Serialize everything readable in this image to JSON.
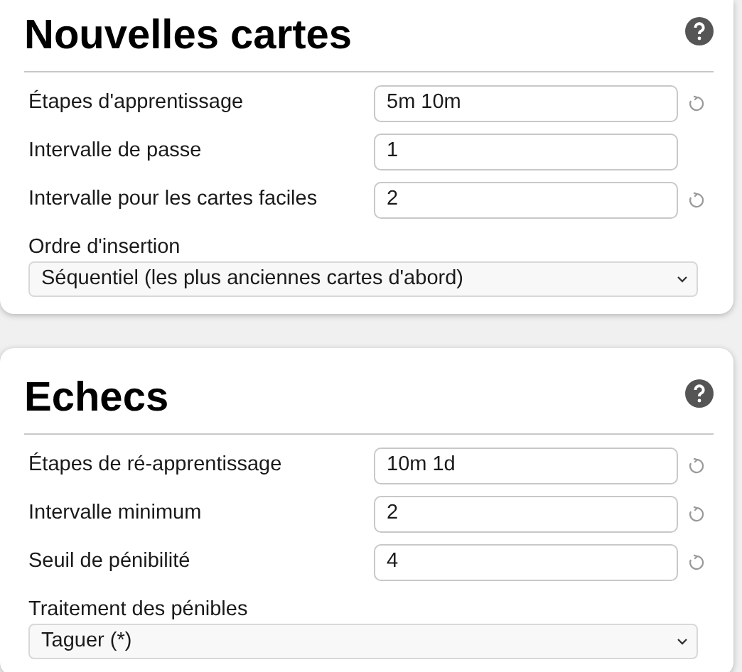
{
  "sections": [
    {
      "title": "Nouvelles cartes",
      "fields": [
        {
          "kind": "text",
          "label": "Étapes d'apprentissage",
          "value": "5m 10m",
          "reset": true
        },
        {
          "kind": "text",
          "label": "Intervalle de passe",
          "value": "1",
          "reset": false
        },
        {
          "kind": "text",
          "label": "Intervalle pour les cartes faciles",
          "value": "2",
          "reset": true
        },
        {
          "kind": "select",
          "label": "Ordre d'insertion",
          "value": "Séquentiel (les plus anciennes cartes d'abord)"
        }
      ]
    },
    {
      "title": "Echecs",
      "fields": [
        {
          "kind": "text",
          "label": "Étapes de ré-apprentissage",
          "value": "10m 1d",
          "reset": true
        },
        {
          "kind": "text",
          "label": "Intervalle minimum",
          "value": "2",
          "reset": true
        },
        {
          "kind": "text",
          "label": "Seuil de pénibilité",
          "value": "4",
          "reset": true
        },
        {
          "kind": "select",
          "label": "Traitement des pénibles",
          "value": "Taguer (*)"
        }
      ]
    }
  ]
}
